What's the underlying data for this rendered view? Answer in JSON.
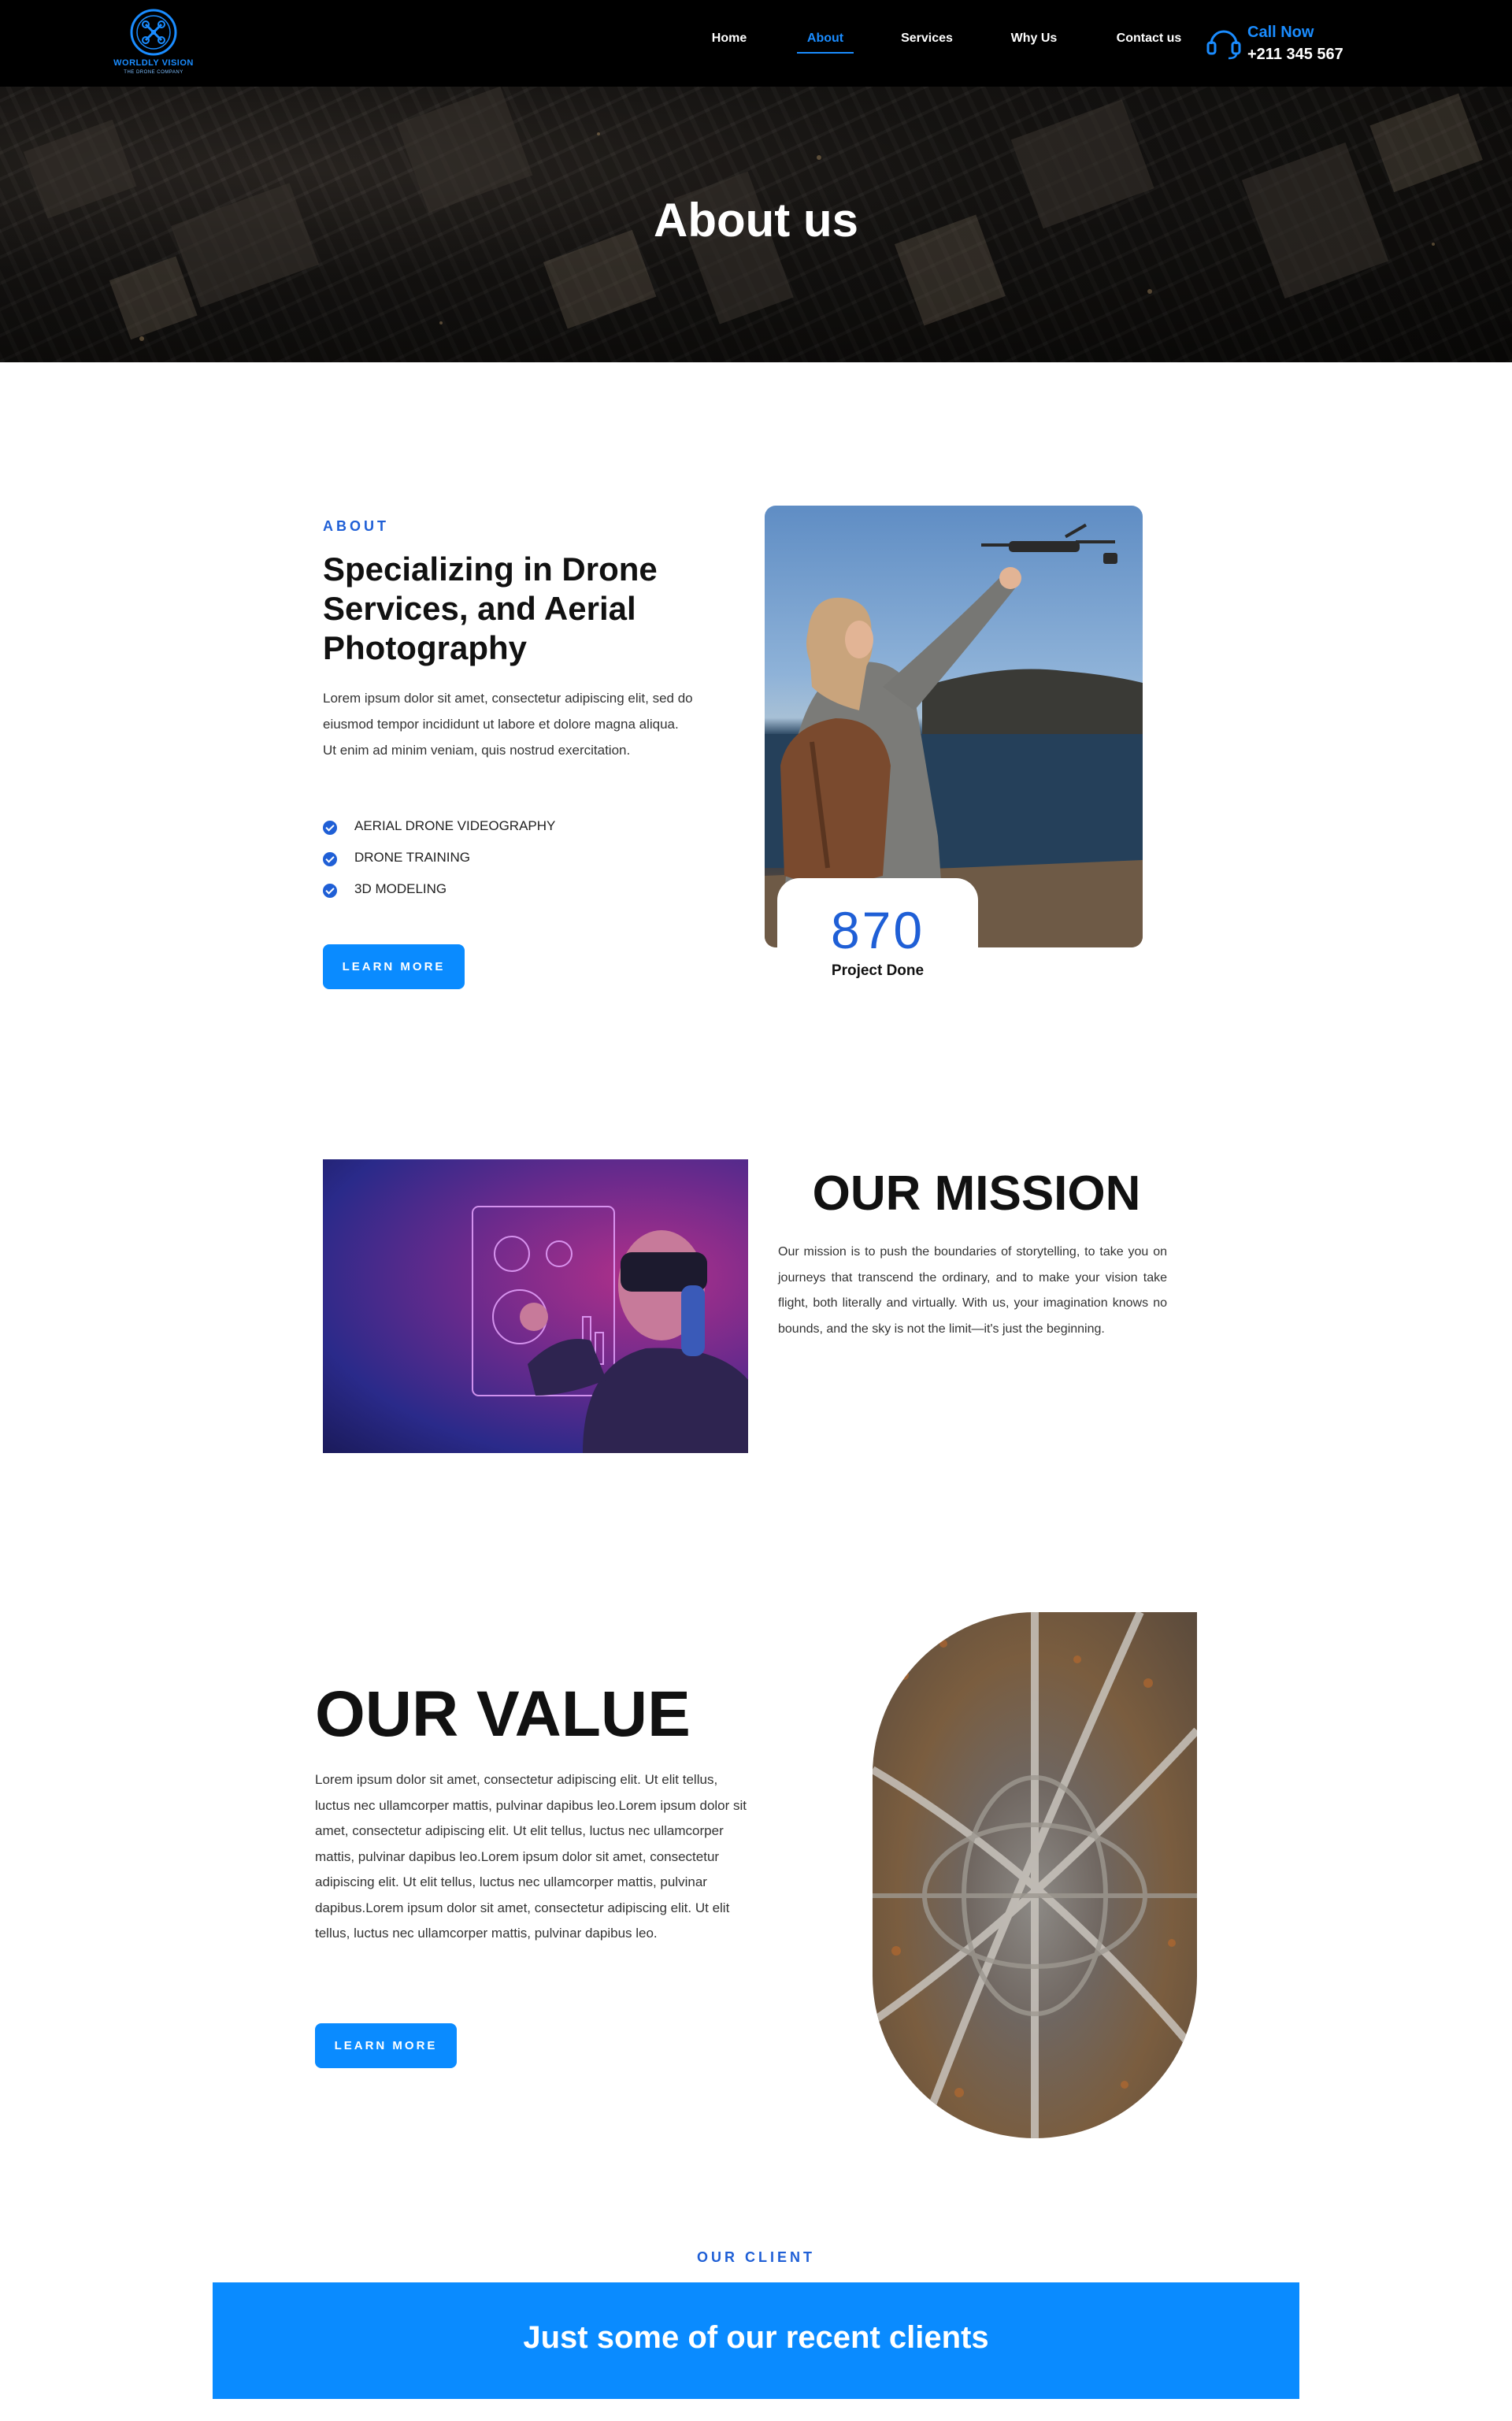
{
  "brand": {
    "name": "WORLDLY VISION",
    "tagline": "THE DRONE COMPANY",
    "accent_color": "#1a8cff"
  },
  "nav": {
    "items": [
      {
        "label": "Home",
        "active": false
      },
      {
        "label": "About",
        "active": true
      },
      {
        "label": "Services",
        "active": false
      },
      {
        "label": "Why Us",
        "active": false
      },
      {
        "label": "Contact us",
        "active": false
      }
    ]
  },
  "call": {
    "label": "Call Now",
    "number": "+211 345 567",
    "icon": "headset-icon"
  },
  "hero": {
    "title": "About us"
  },
  "about": {
    "eyebrow": "ABOUT",
    "heading": "Specializing in Drone Services, and Aerial Photography",
    "text": "Lorem ipsum dolor sit amet, consectetur adipiscing elit, sed do eiusmod tempor incididunt ut labore et dolore magna aliqua. Ut enim ad minim veniam, quis nostrud exercitation.",
    "list": [
      "AERIAL DRONE VIDEOGRAPHY",
      "DRONE TRAINING",
      "3D MODELING"
    ],
    "button": "LEARN MORE",
    "counter": {
      "value": "870",
      "label": "Project Done"
    }
  },
  "mission": {
    "title": "OUR MISSION",
    "text": "Our mission is to push the boundaries of storytelling, to take you on journeys that transcend the ordinary, and to make your vision take flight, both literally and virtually. With us, your imagination knows no bounds, and the sky is not the limit—it's just the beginning."
  },
  "value": {
    "title": "OUR VALUE",
    "text": "Lorem ipsum dolor sit amet, consectetur adipiscing elit. Ut elit tellus, luctus nec ullamcorper mattis, pulvinar dapibus leo.Lorem ipsum dolor sit amet, consectetur adipiscing elit. Ut elit tellus, luctus nec ullamcorper mattis, pulvinar dapibus leo.Lorem ipsum dolor sit amet, consectetur adipiscing elit. Ut elit tellus, luctus nec ullamcorper mattis, pulvinar dapibus.Lorem ipsum dolor sit amet, consectetur adipiscing elit. Ut elit tellus, luctus nec ullamcorper mattis, pulvinar dapibus leo.",
    "button": "LEARN MORE"
  },
  "clients": {
    "eyebrow": "OUR CLIENT",
    "heading": "Just some of our recent clients",
    "banner_color": "#0a8bff"
  }
}
